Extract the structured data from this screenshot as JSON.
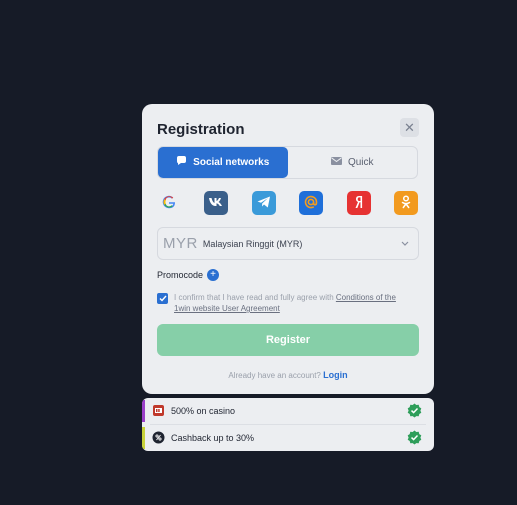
{
  "modal": {
    "title": "Registration",
    "close_glyph": "✕",
    "tabs": [
      {
        "label": "Social networks",
        "icon": "chat-bubble-icon",
        "active": true
      },
      {
        "label": "Quick",
        "icon": "envelope-icon",
        "active": false
      }
    ],
    "socials": [
      {
        "name": "Google",
        "icon": "google-icon",
        "color": "#ffffff"
      },
      {
        "name": "VK",
        "icon": "vk-icon",
        "color": "#3a5f8a"
      },
      {
        "name": "Telegram",
        "icon": "telegram-icon",
        "color": "#3a9ad9"
      },
      {
        "name": "Mail.ru",
        "icon": "mailru-icon",
        "color": "#1f6fd9"
      },
      {
        "name": "Yandex",
        "icon": "yandex-icon",
        "color": "#e63232"
      },
      {
        "name": "Odnoklassniki",
        "icon": "ok-icon",
        "color": "#f29a1f"
      }
    ],
    "currency": {
      "code": "MYR",
      "name": "Malaysian Ringgit (MYR)"
    },
    "promocode_label": "Promocode",
    "agree": {
      "checked": true,
      "text": "I confirm that I have read and fully agree with ",
      "link": "Conditions of the 1win website User Agreement"
    },
    "register_label": "Register",
    "login_prompt": "Already have an account?",
    "login_link": "Login"
  },
  "bonuses": [
    {
      "text": "500% on casino",
      "icon": "casino-icon",
      "bar_color": "#9b3fc8"
    },
    {
      "text": "Cashback up to 30%",
      "icon": "cashback-icon",
      "bar_color": "#c8d23a"
    }
  ],
  "colors": {
    "background": "#161b27",
    "accent": "#2a6fd1",
    "register_button": "#86cfa8",
    "success": "#2e9e5a"
  }
}
